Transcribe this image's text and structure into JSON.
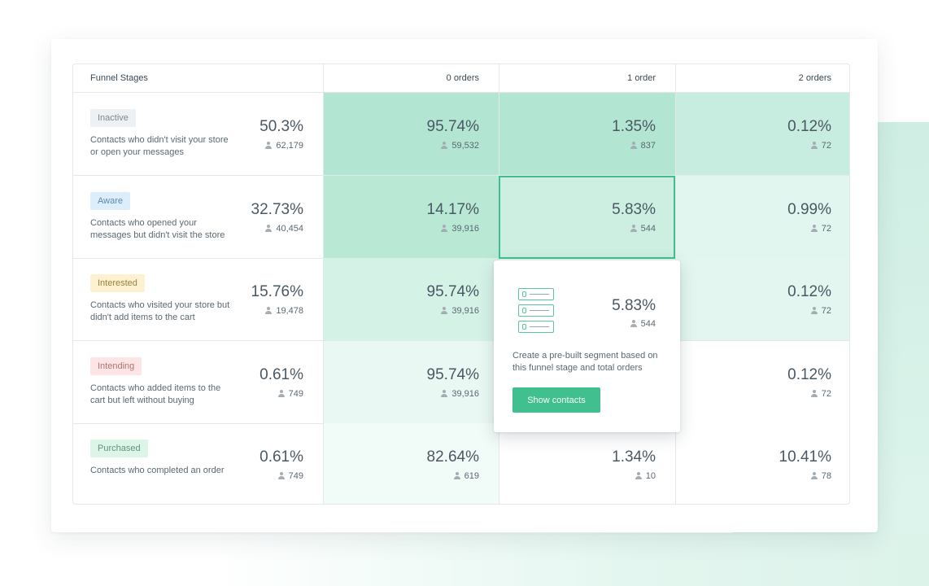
{
  "table": {
    "header": {
      "stage_col": "Funnel Stages",
      "columns": [
        "0 orders",
        "1 order",
        "2 orders"
      ]
    },
    "rows": [
      {
        "badge": "Inactive",
        "badge_bg": "#eef1f3",
        "badge_color": "#7b8790",
        "description": "Contacts who didn't visit your store or open your messages",
        "pct": "50.3%",
        "count": "62,179",
        "cells": [
          {
            "pct": "95.74%",
            "count": "59,532",
            "bg": "#b3e6d2"
          },
          {
            "pct": "1.35%",
            "count": "837",
            "bg": "#b3e6d2"
          },
          {
            "pct": "0.12%",
            "count": "72",
            "bg": "#c7ede0"
          }
        ]
      },
      {
        "badge": "Aware",
        "badge_bg": "#dceefb",
        "badge_color": "#5f87ab",
        "description": "Contacts who opened your messages but didn't visit the store",
        "pct": "32.73%",
        "count": "40,454",
        "cells": [
          {
            "pct": "14.17%",
            "count": "39,916",
            "bg": "#b9e8d5"
          },
          {
            "pct": "5.83%",
            "count": "544",
            "bg": "#ccefe2"
          },
          {
            "pct": "0.99%",
            "count": "72",
            "bg": "#e1f6ee"
          }
        ]
      },
      {
        "badge": "Interested",
        "badge_bg": "#fdf1cf",
        "badge_color": "#9c8140",
        "description": "Contacts who visited your store but didn't add items to the cart",
        "pct": "15.76%",
        "count": "19,478",
        "cells": [
          {
            "pct": "95.74%",
            "count": "39,916",
            "bg": "#d5f2e7"
          },
          {
            "pct": "",
            "count": "",
            "bg": "#e6f8f1"
          },
          {
            "pct": "0.12%",
            "count": "72",
            "bg": "#e3f6ef"
          }
        ]
      },
      {
        "badge": "Intending",
        "badge_bg": "#fde5e5",
        "badge_color": "#b27373",
        "description": "Contacts who added items to the cart but left without buying",
        "pct": "0.61%",
        "count": "749",
        "cells": [
          {
            "pct": "95.74%",
            "count": "39,916",
            "bg": "#e9f8f2"
          },
          {
            "pct": "",
            "count": "",
            "bg": "#ffffff"
          },
          {
            "pct": "0.12%",
            "count": "72",
            "bg": "#ffffff"
          }
        ]
      },
      {
        "badge": "Purchased",
        "badge_bg": "#ddf4e8",
        "badge_color": "#5f9478",
        "description": "Contacts who completed an order",
        "pct": "0.61%",
        "count": "749",
        "cells": [
          {
            "pct": "82.64%",
            "count": "619",
            "bg": "#f1fbf7"
          },
          {
            "pct": "1.34%",
            "count": "10",
            "bg": "#ffffff"
          },
          {
            "pct": "10.41%",
            "count": "78",
            "bg": "#ffffff"
          }
        ]
      }
    ]
  },
  "popover": {
    "pct": "5.83%",
    "count": "544",
    "text": "Create a pre-built segment based on this funnel stage and total orders",
    "button": "Show contacts",
    "icon": "contact-cards-icon"
  },
  "colors": {
    "accent": "#3fc08e",
    "selection": "#3fbf8f"
  }
}
